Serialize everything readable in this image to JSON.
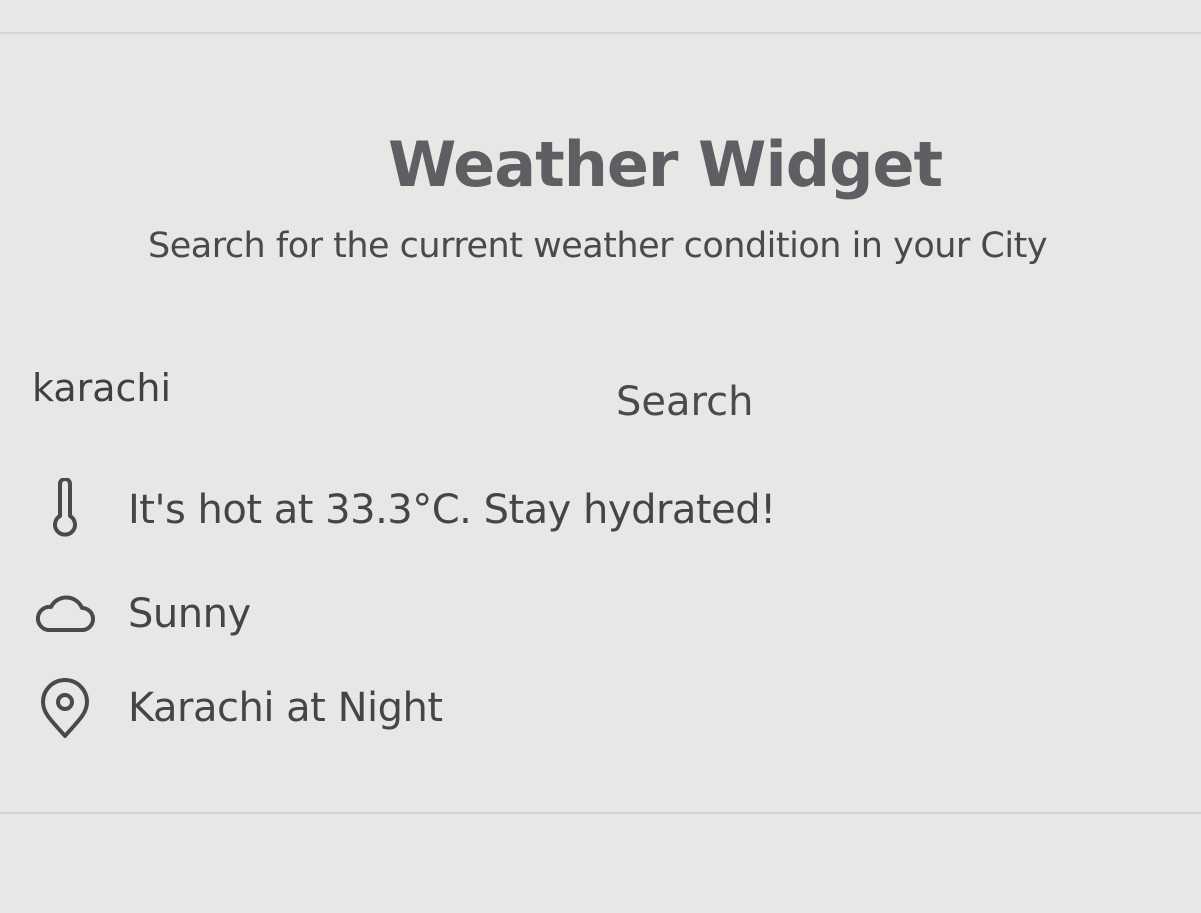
{
  "widget": {
    "title": "Weather Widget",
    "subtitle": "Search for the current weather condition in your City"
  },
  "search": {
    "value": "karachi",
    "button_label": "Search"
  },
  "results": {
    "temperature_text": "It's hot at 33.3°C. Stay hydrated!",
    "condition_text": "Sunny",
    "location_text": "Karachi at Night"
  },
  "icons": {
    "temperature": "thermometer-icon",
    "condition": "cloud-icon",
    "location": "map-pin-icon"
  }
}
